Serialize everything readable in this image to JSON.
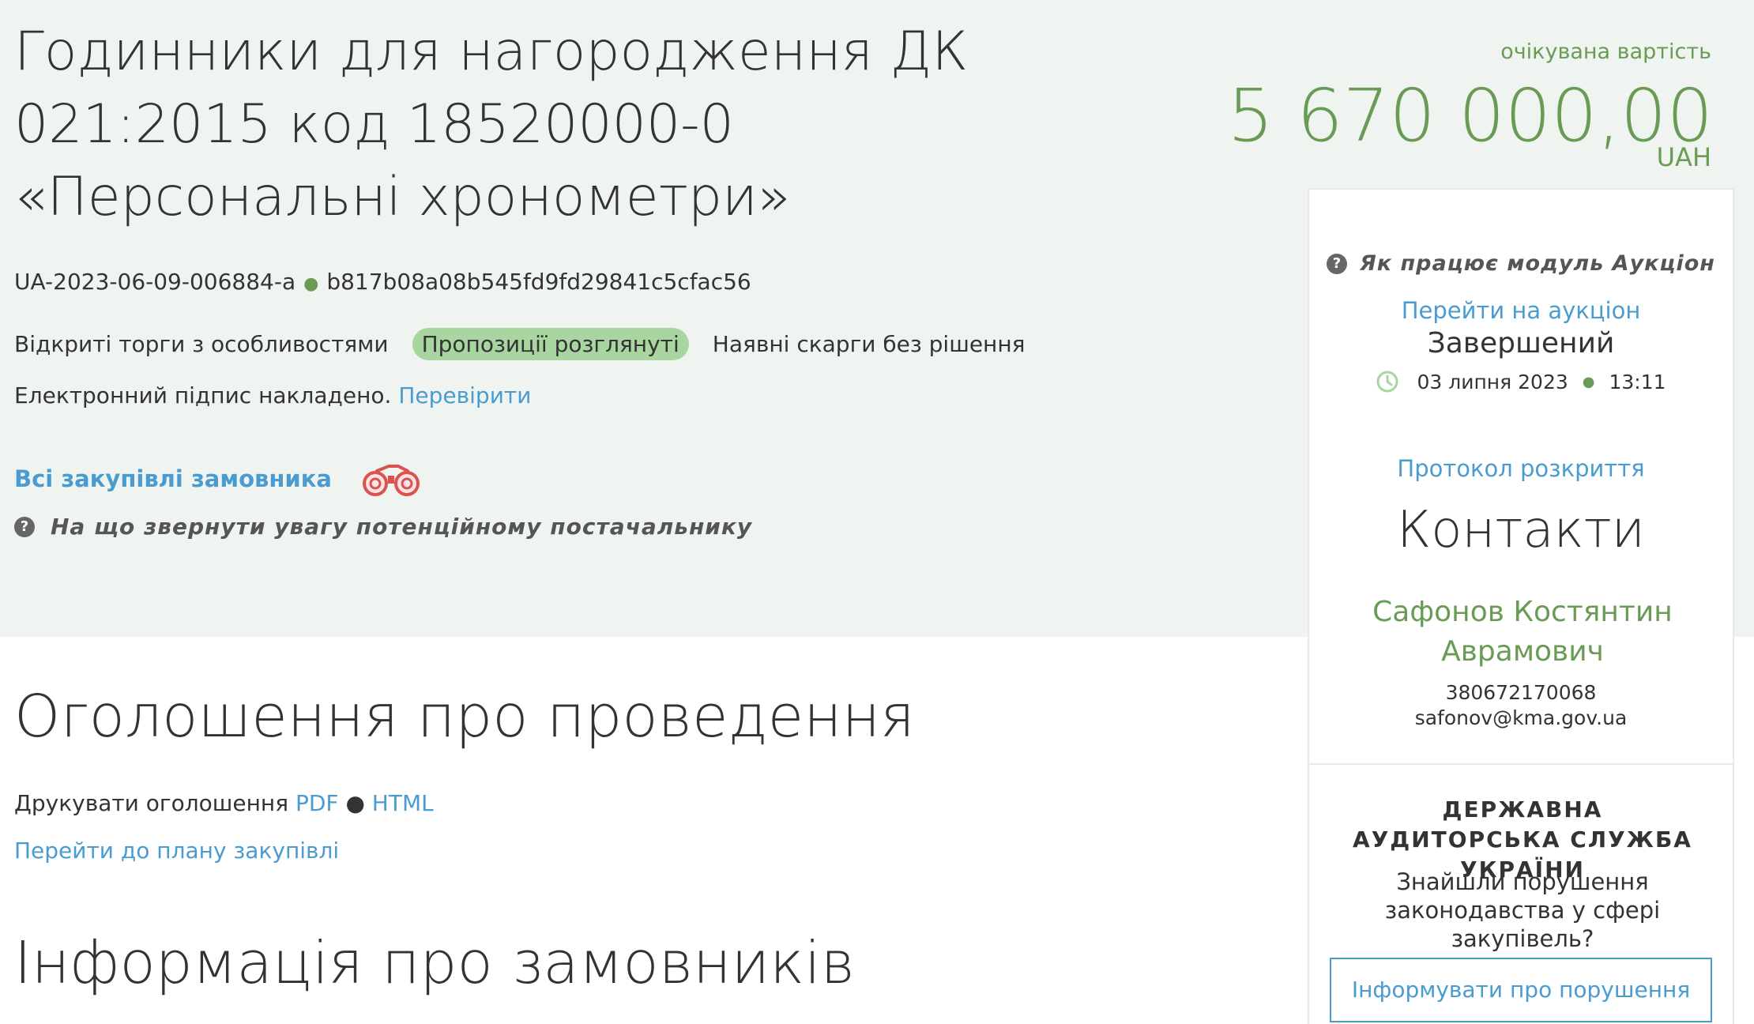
{
  "tender": {
    "title": "Годинники для нагородження ДК 021:2015 код 18520000-0 «Персональні хронометри»",
    "id": "UA-2023-06-09-006884-a",
    "hash": "b817b08a08b545fd9fd29841c5cfac56",
    "procedure": "Відкриті торги з особливостями",
    "status_badge": "Пропозиції розглянуті",
    "complaints": "Наявні скарги без рішення",
    "signature_text": "Електронний підпис накладено.",
    "verify_link": "Перевірити",
    "all_purchases_link": "Всі закупівлі замовника",
    "supplier_hint": "На що звернути увагу потенційному постачальнику"
  },
  "cost": {
    "label": "очікувана вартість",
    "value": "5 670 000,00",
    "currency": "UAH"
  },
  "sections": {
    "announcement_title": "Оголошення про проведення",
    "print_label": "Друкувати оголошення",
    "pdf_link": "PDF",
    "html_link": "HTML",
    "plan_link": "Перейти до плану закупівлі",
    "customers_title": "Інформація про замовників"
  },
  "sidebar": {
    "auction_help": "Як працює модуль Аукціон",
    "auction_link": "Перейти на аукціон",
    "auction_status": "Завершений",
    "auction_date": "03 липня 2023",
    "auction_time": "13:11",
    "protocol_link": "Протокол розкриття",
    "contacts_title": "Контакти",
    "contact_name": "Сафонов Костянтин Аврамович",
    "contact_phone": "380672170068",
    "contact_email": "safonov@kma.gov.ua",
    "das_title": "ДЕРЖАВНА АУДИТОРСЬКА СЛУЖБА УКРАЇНИ",
    "das_question": "Знайшли порушення законодавства у сфері закупівель?",
    "report_button": "Інформувати про порушення"
  },
  "colors": {
    "hero_bg": "#f0f4f1",
    "accent_green": "#6a9b55",
    "badge_green": "#a8d5a0",
    "link_blue": "#4a9cd0"
  },
  "icons": {
    "help": "question-circle-icon",
    "binoculars": "binoculars-icon",
    "clock": "clock-icon"
  }
}
